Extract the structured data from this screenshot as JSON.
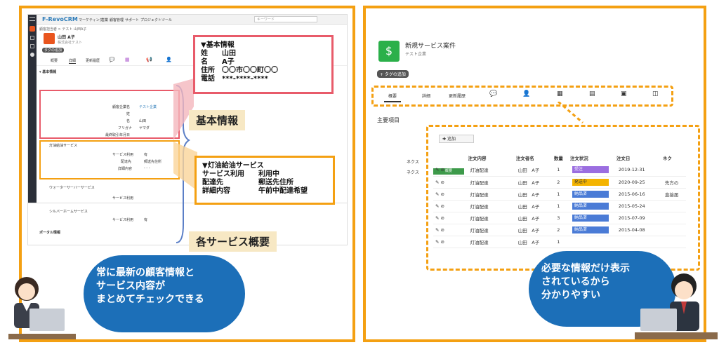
{
  "left": {
    "app_logo": "F-RevoCRM",
    "menu": [
      "マーケティング",
      "営業",
      "顧客管理",
      "サポート",
      "プロジェクト",
      "ツール"
    ],
    "search_placeholder": "キーワード",
    "breadcrumb": "顧客担当者 > テスト 山田A子",
    "contact_name": "山田 A子",
    "contact_sub": "株式会社テスト",
    "tag_button": "タグの追加",
    "tabs": [
      "概要",
      "詳細",
      "更新履歴"
    ],
    "section_basic": "▼基本情報",
    "basic_fields": [
      {
        "label": "顧客企業名",
        "value": "テスト企業"
      },
      {
        "label": "姓",
        "value": "山田"
      },
      {
        "label": "名",
        "value": "山田"
      },
      {
        "label": "フリガナ",
        "value": "ヤマダ"
      },
      {
        "label": "最終取引年月日",
        "value": ""
      }
    ],
    "section_oil": "灯油給油サービス",
    "oil_fields": [
      {
        "label": "サービス利用",
        "value": "有"
      },
      {
        "label": "配達先",
        "value": "郵送先住所"
      },
      {
        "label": "詳細内容",
        "value": "- - -"
      }
    ],
    "section_water": "ウォーターサーバーサービス",
    "water_fields": [
      {
        "label": "サービス利用",
        "value": "☑"
      }
    ],
    "section_silver": "シルバーホームサービス",
    "silver_fields": [
      {
        "label": "サービス利用",
        "value": "有"
      }
    ],
    "section_portal": "ポータル情報",
    "callout_basic": "▼基本情報\n姓　　山田\n名　　A子\n住所　〇〇市〇〇町〇〇\n電話　***-****-****",
    "label_basic": "基本情報",
    "callout_oil": "▼灯油給油サービス\nサービス利用　　利用中\n配達先　　　　　郵送先住所\n詳細内容　　　　午前中配達希望",
    "label_services": "各サービス概要",
    "cloud_text": "常に最新の顧客情報と\nサービス内容が\nまとめてチェックできる"
  },
  "right": {
    "record_title": "新規サービス案件",
    "record_sub": "テスト企業",
    "tag_button": "+ タグの追加",
    "tabs": [
      "概要",
      "詳細",
      "更新履歴"
    ],
    "tab_icons": [
      "comment-icon",
      "person-icon",
      "calendar-icon",
      "document-icon",
      "contact-card-icon",
      "id-card-icon"
    ],
    "section_title": "主要項目",
    "add_button": "追加",
    "side_labels": [
      "ネクス",
      "ネクス"
    ],
    "side_button": "概要",
    "columns": [
      "注文内容",
      "注文者名",
      "数量",
      "注文状況",
      "注文日",
      "ネク"
    ],
    "rows": [
      {
        "item": "灯油配達",
        "name": "山田　A子",
        "qty": "1",
        "status": "受注",
        "status_color": "#9b6ee0",
        "date": "2019-12-31",
        "extra": ""
      },
      {
        "item": "灯油配達",
        "name": "山田　A子",
        "qty": "2",
        "status": "発送中",
        "status_color": "#f4b400",
        "date": "2020-09-25",
        "extra": "先方の"
      },
      {
        "item": "灯油配達",
        "name": "山田　A子",
        "qty": "1",
        "status": "納品済",
        "status_color": "#4a7bd6",
        "date": "2015-06-16",
        "extra": "直接届"
      },
      {
        "item": "灯油配達",
        "name": "山田　A子",
        "qty": "1",
        "status": "納品済",
        "status_color": "#4a7bd6",
        "date": "2015-05-24",
        "extra": ""
      },
      {
        "item": "灯油配達",
        "name": "山田　A子",
        "qty": "3",
        "status": "納品済",
        "status_color": "#4a7bd6",
        "date": "2015-07-09",
        "extra": ""
      },
      {
        "item": "灯油配達",
        "name": "山田　A子",
        "qty": "2",
        "status": "納品済",
        "status_color": "#4a7bd6",
        "date": "2015-04-08",
        "extra": ""
      },
      {
        "item": "灯油配達",
        "name": "山田　A子",
        "qty": "1",
        "status": "",
        "status_color": "#ffffff",
        "date": "",
        "extra": ""
      }
    ],
    "cloud_text": "必要な情報だけ表示\nされているから\n分かりやすい"
  },
  "colors": {
    "frame": "#f4a012",
    "red_highlight": "#e85b6a",
    "cloud": "#1c6fb8",
    "label_bg": "#f7e8c4"
  }
}
